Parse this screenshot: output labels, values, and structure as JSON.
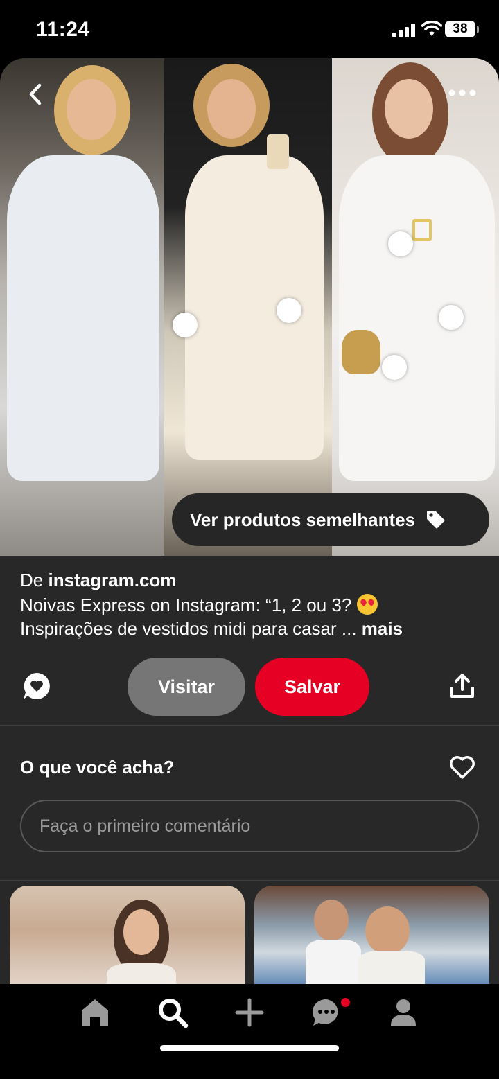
{
  "status_bar": {
    "time": "11:24",
    "battery": "38"
  },
  "pin": {
    "similar_products_label": "Ver produtos semelhantes",
    "source_prefix": "De",
    "source_domain": "instagram.com",
    "description_line1": "Noivas Express on Instagram: “1, 2 ou 3?",
    "description_line2": "Inspirações de vestidos midi para casar ...",
    "more_label": "mais"
  },
  "actions": {
    "visit_label": "Visitar",
    "save_label": "Salvar"
  },
  "comments": {
    "title": "O que você acha?",
    "placeholder": "Faça o primeiro comentário"
  },
  "icons": {
    "back": "chevron-left-icon",
    "more": "more-icon",
    "tag": "tag-icon",
    "comment": "comment-icon",
    "share": "share-icon",
    "heart": "heart-icon",
    "nav": [
      "home-icon",
      "search-icon",
      "plus-icon",
      "messages-icon",
      "profile-icon"
    ]
  },
  "colors": {
    "save": "#e60023",
    "visit": "#767676",
    "card": "#282828",
    "notification": "#e60023"
  }
}
